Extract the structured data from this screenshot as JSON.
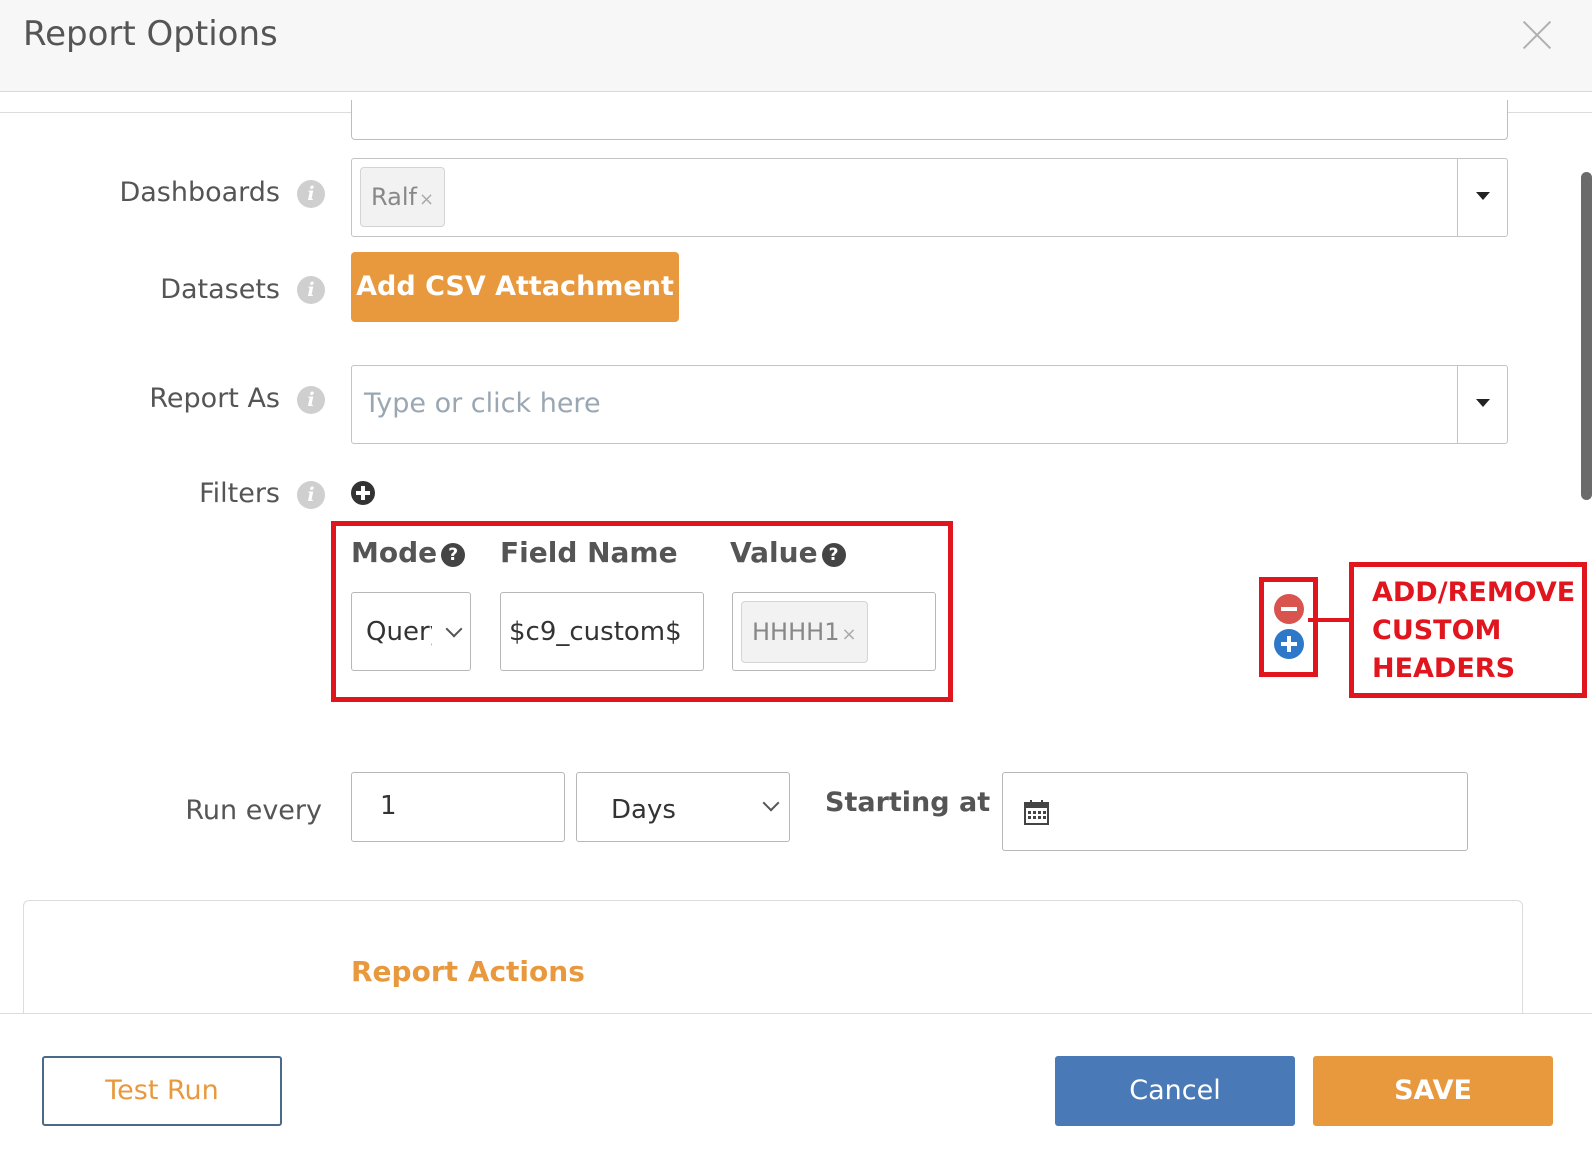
{
  "modal": {
    "title": "Report Options"
  },
  "form": {
    "dashboards": {
      "label": "Dashboards",
      "tag": "Ralf",
      "tag_remove": "×"
    },
    "datasets": {
      "label": "Datasets",
      "button": "Add CSV Attachment"
    },
    "report_as": {
      "label": "Report As",
      "placeholder": "Type or click here"
    },
    "filters": {
      "label": "Filters",
      "columns": {
        "mode": "Mode",
        "field_name": "Field Name",
        "value": "Value"
      },
      "row": {
        "mode": "Query",
        "field_name": "$c9_custom$",
        "value_tag": "HHHH1",
        "value_remove": "×"
      }
    },
    "schedule": {
      "label": "Run every",
      "interval": "1",
      "unit": "Days",
      "starting_label": "Starting at"
    }
  },
  "annotation": {
    "line1": "ADD/REMOVE",
    "line2": "CUSTOM",
    "line3": "HEADERS"
  },
  "actions": {
    "title": "Report Actions"
  },
  "footer": {
    "test_run": "Test Run",
    "cancel": "Cancel",
    "save": "SAVE"
  },
  "icons": {
    "info": "info-icon",
    "help": "question-circle-icon",
    "add": "plus-circle-icon",
    "remove": "minus-circle-icon",
    "calendar": "calendar-icon",
    "close": "close-icon"
  },
  "colors": {
    "accent": "#e8993e",
    "primary": "#4a79b8",
    "annotation": "#e1151e",
    "remove": "#d9534f",
    "add": "#2d78c9"
  }
}
